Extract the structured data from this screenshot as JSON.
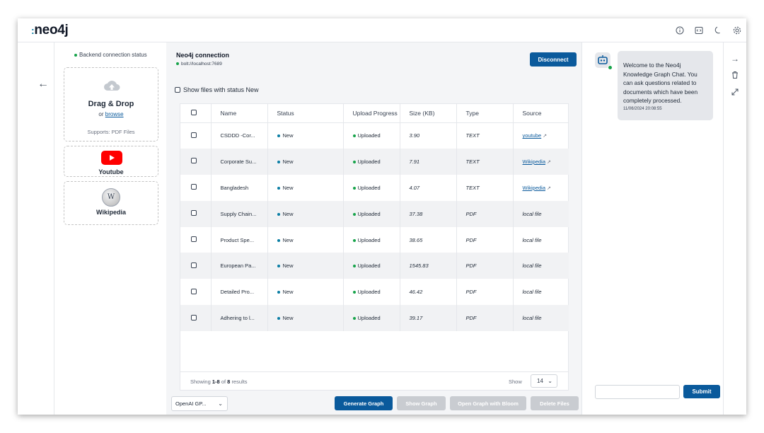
{
  "app": {
    "logo_text": "neo4j",
    "logo_dots": ":",
    "top_icons": [
      "info-icon",
      "code-icon",
      "moon-icon",
      "gear-icon"
    ]
  },
  "sources": {
    "connection_status": "Backend connection status",
    "dropzone": {
      "title": "Drag & Drop",
      "or_text": "or",
      "browse_label": "browse",
      "supports": "Supports: PDF Files"
    },
    "youtube_label": "Youtube",
    "wikipedia_label": "Wikipedia"
  },
  "connection": {
    "title": "Neo4j connection",
    "url": "bolt://localhost:7689",
    "disconnect_label": "Disconnect"
  },
  "filter": {
    "label": "Show files with status New"
  },
  "table": {
    "columns": [
      "Name",
      "Status",
      "Upload Progress",
      "Size (KB)",
      "Type",
      "Source"
    ],
    "rows": [
      {
        "name": "CSDDD -Cor...",
        "status": "New",
        "progress": "Uploaded",
        "size": "3.90",
        "type": "TEXT",
        "source": "youtube",
        "source_link": true
      },
      {
        "name": "Corporate Su...",
        "status": "New",
        "progress": "Uploaded",
        "size": "7.91",
        "type": "TEXT",
        "source": "Wikipedia",
        "source_link": true
      },
      {
        "name": "Bangladesh",
        "status": "New",
        "progress": "Uploaded",
        "size": "4.07",
        "type": "TEXT",
        "source": "Wikipedia",
        "source_link": true
      },
      {
        "name": "Supply Chain...",
        "status": "New",
        "progress": "Uploaded",
        "size": "37.38",
        "type": "PDF",
        "source": "local file",
        "source_link": false
      },
      {
        "name": "Product Spe...",
        "status": "New",
        "progress": "Uploaded",
        "size": "38.65",
        "type": "PDF",
        "source": "local file",
        "source_link": false
      },
      {
        "name": "European Pa...",
        "status": "New",
        "progress": "Uploaded",
        "size": "1545.83",
        "type": "PDF",
        "source": "local file",
        "source_link": false
      },
      {
        "name": "Detailed Pro...",
        "status": "New",
        "progress": "Uploaded",
        "size": "46.42",
        "type": "PDF",
        "source": "local file",
        "source_link": false
      },
      {
        "name": "Adhering to l...",
        "status": "New",
        "progress": "Uploaded",
        "size": "39.17",
        "type": "PDF",
        "source": "local file",
        "source_link": false
      }
    ],
    "footer": {
      "showing_prefix": "Showing",
      "range": "1-8",
      "of": "of",
      "total": "8",
      "results": "results",
      "show_label": "Show",
      "page_size": "14"
    }
  },
  "actions": {
    "model": "OpenAI GP...",
    "generate_graph": "Generate Graph",
    "show_graph": "Show Graph",
    "open_bloom": "Open Graph with Bloom",
    "delete_files": "Delete Files"
  },
  "chat": {
    "message": "Welcome to the Neo4j Knowledge Graph Chat. You can ask questions related to documents which have been completely processed.",
    "timestamp": "11/06/2024 20:08:55",
    "input_value": "",
    "submit_label": "Submit"
  },
  "colors": {
    "primary": "#0a5a9c",
    "disabled": "#c9ccd1",
    "status_green": "#16a34a",
    "status_blue": "#0a7ea4"
  }
}
